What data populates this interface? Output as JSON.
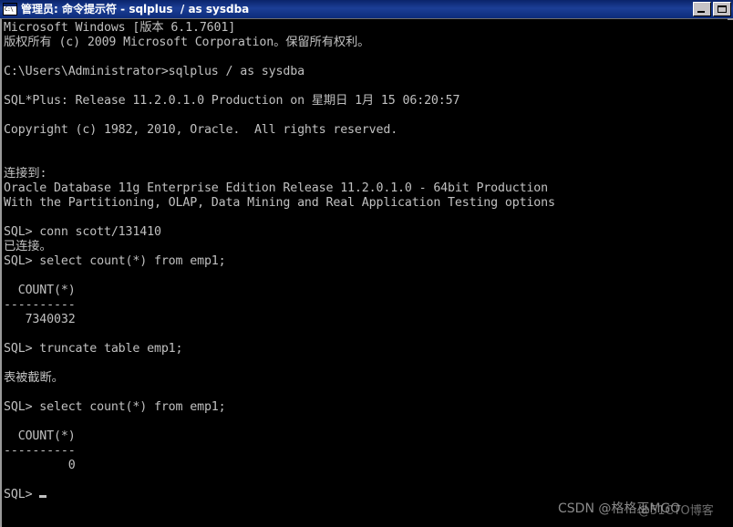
{
  "window": {
    "title": "管理员: 命令提示符 - sqlplus  / as sysdba",
    "icon": "command-prompt-icon",
    "titlebar_color": "#0a246a",
    "background_color": "#000000",
    "text_color": "#c0c0c0",
    "controls": {
      "minimize_label": "",
      "maximize_label": ""
    }
  },
  "terminal": {
    "lines": [
      "Microsoft Windows [版本 6.1.7601]",
      "版权所有 (c) 2009 Microsoft Corporation。保留所有权利。",
      "",
      "C:\\Users\\Administrator>sqlplus / as sysdba",
      "",
      "SQL*Plus: Release 11.2.0.1.0 Production on 星期日 1月 15 06:20:57",
      "",
      "Copyright (c) 1982, 2010, Oracle.  All rights reserved.",
      "",
      "",
      "连接到:",
      "Oracle Database 11g Enterprise Edition Release 11.2.0.1.0 - 64bit Production",
      "With the Partitioning, OLAP, Data Mining and Real Application Testing options",
      "",
      "SQL> conn scott/131410",
      "已连接。",
      "SQL> select count(*) from emp1;",
      "",
      "  COUNT(*)",
      "----------",
      "   7340032",
      "",
      "SQL> truncate table emp1;",
      "",
      "表被截断。",
      "",
      "SQL> select count(*) from emp1;",
      "",
      "  COUNT(*)",
      "----------",
      "         0",
      "",
      "SQL> "
    ],
    "prompt": "SQL> ",
    "cursor_visible": true
  },
  "watermarks": {
    "csdn": "CSDN @格格巫MGO",
    "cto": "@51CTO博客"
  }
}
